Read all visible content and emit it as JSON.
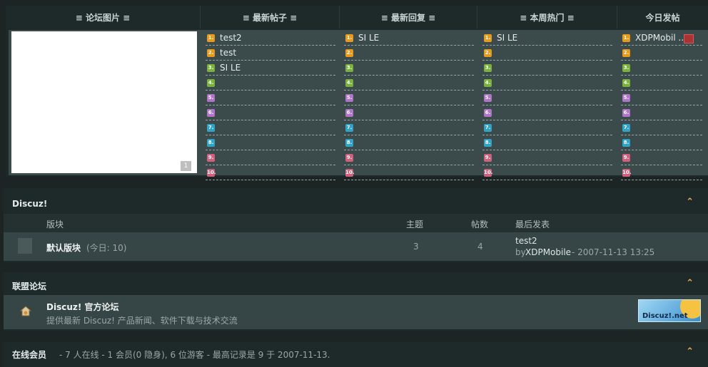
{
  "hot": {
    "tabs": [
      "≡ 论坛图片 ≡",
      "≡ 最新帖子 ≡",
      "≡ 最新回复 ≡",
      "≡ 本周热门 ≡",
      "今日发帖"
    ],
    "pic_nav": "1",
    "num_colors": [
      "#e89a1a",
      "#e89a1a",
      "#7ab33c",
      "#7ab33c",
      "#b074c8",
      "#b074c8",
      "#2fa3c8",
      "#2fa3c8",
      "#d0607c",
      "#d0607c"
    ],
    "num_labels": [
      "1.",
      "2.",
      "3.",
      "4.",
      "5.",
      "6.",
      "7.",
      "8.",
      "9.",
      "10."
    ],
    "newest_posts": [
      "test2",
      "test",
      "SI LE",
      "",
      "",
      "",
      "",
      "",
      "",
      ""
    ],
    "newest_replies": [
      "SI LE",
      "",
      "",
      "",
      "",
      "",
      "",
      "",
      "",
      ""
    ],
    "weekly_hot": [
      "SI LE",
      "",
      "",
      "",
      "",
      "",
      "",
      "",
      "",
      ""
    ],
    "today_posts": [
      "XDPMobil ...",
      "",
      "",
      "",
      "",
      "",
      "",
      "",
      "",
      ""
    ]
  },
  "discuz": {
    "title": "Discuz!",
    "collapse": "⌃",
    "cols": {
      "forum": "版块",
      "threads": "主题",
      "posts": "帖数",
      "last": "最后发表"
    },
    "forum": {
      "name": "默认版块",
      "today": "(今日: 10)",
      "threads": "3",
      "posts": "4",
      "last_title": "test2",
      "last_by": "by",
      "last_user": "XDPMobile",
      "last_time": "- 2007-11-13 13:25"
    }
  },
  "union": {
    "title": "联盟论坛",
    "collapse": "⌃",
    "name": "Discuz! 官方论坛",
    "desc": "提供最新 Discuz! 产品新闻、软件下载与技术交流",
    "logo": "Discuz!.net"
  },
  "online": {
    "title": "在线会员",
    "text": "- 7 人在线 - 1 会员(0 隐身), 6 位游客 - 最高记录是 9 于 2007-11-13.",
    "collapse": "⌃"
  }
}
